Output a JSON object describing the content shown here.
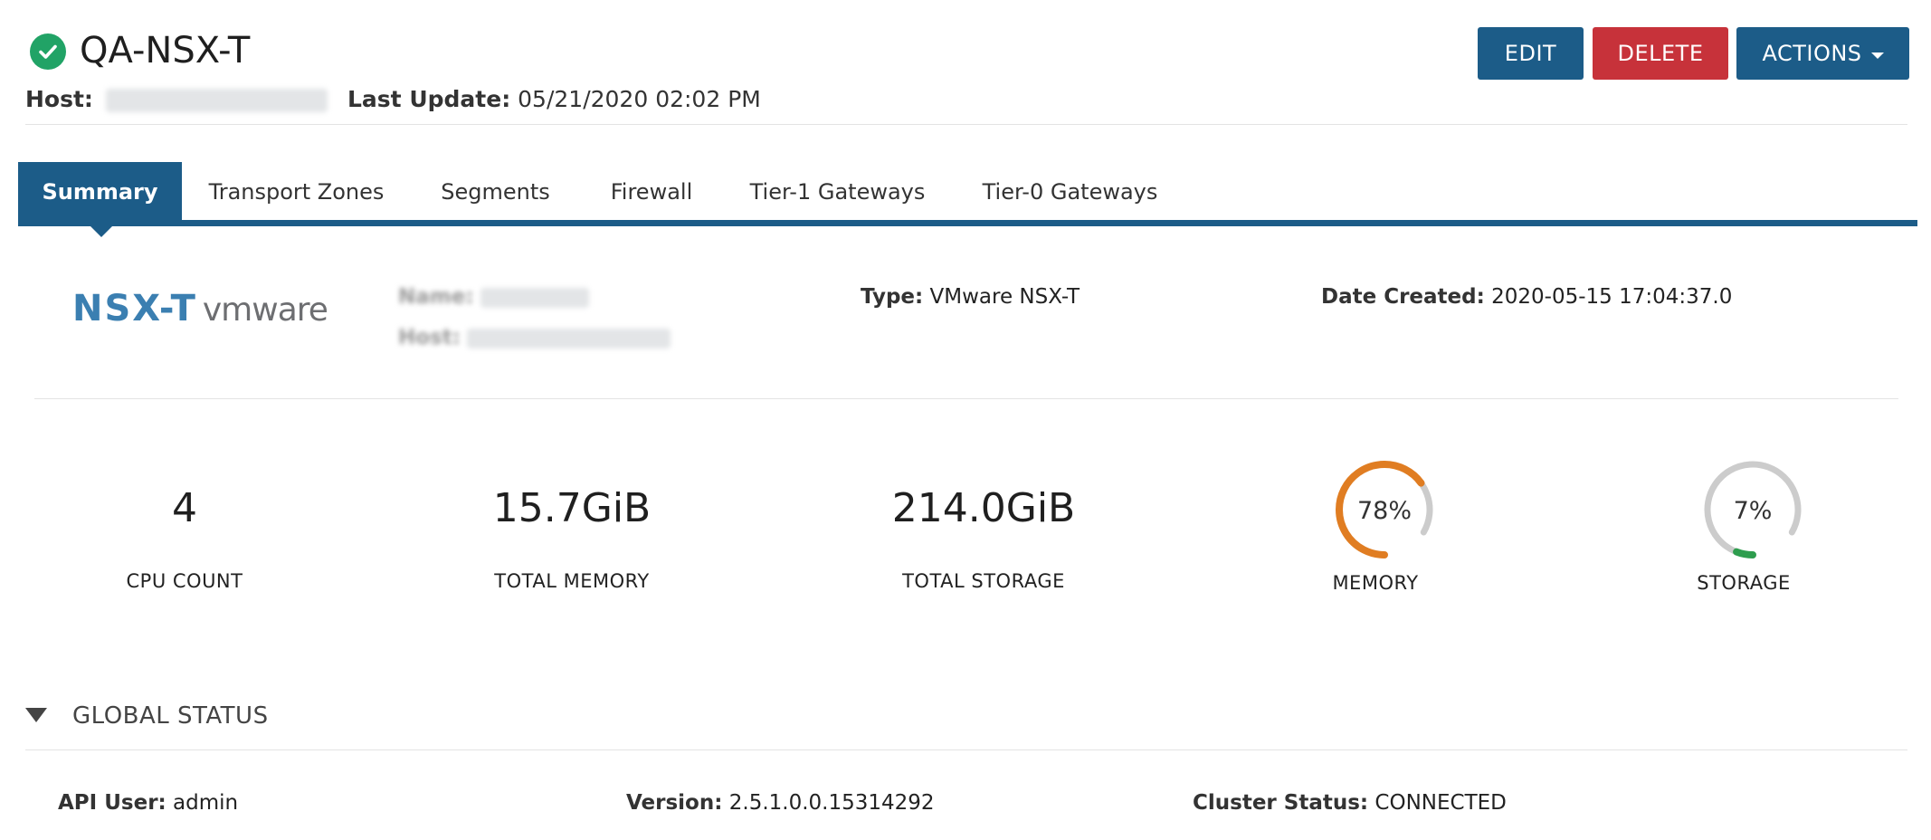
{
  "header": {
    "title": "QA-NSX-T",
    "status_icon": "check-circle-icon",
    "host_label": "Host:",
    "last_update_label": "Last Update:",
    "last_update_value": "05/21/2020 02:02 PM"
  },
  "toolbar": {
    "edit_label": "EDIT",
    "delete_label": "DELETE",
    "actions_label": "ACTIONS"
  },
  "tabs": [
    {
      "label": "Summary",
      "active": true
    },
    {
      "label": "Transport Zones",
      "active": false
    },
    {
      "label": "Segments",
      "active": false
    },
    {
      "label": "Firewall",
      "active": false
    },
    {
      "label": "Tier-1 Gateways",
      "active": false
    },
    {
      "label": "Tier-0 Gateways",
      "active": false
    }
  ],
  "logo": {
    "product": "NSX-T",
    "vendor": "vmware"
  },
  "details": {
    "name_label": "Name:",
    "host_label": "Host:",
    "type_label": "Type:",
    "type_value": "VMware NSX-T",
    "date_created_label": "Date Created:",
    "date_created_value": "2020-05-15 17:04:37.0"
  },
  "stats": {
    "cpu_count": {
      "value": "4",
      "label": "CPU COUNT"
    },
    "total_memory": {
      "value": "15.7GiB",
      "label": "TOTAL MEMORY"
    },
    "total_storage": {
      "value": "214.0GiB",
      "label": "TOTAL STORAGE"
    },
    "memory": {
      "percent": 78,
      "text": "78%",
      "label": "MEMORY",
      "color": "#e07d22"
    },
    "storage": {
      "percent": 7,
      "text": "7%",
      "label": "STORAGE",
      "color": "#2e9d4e"
    }
  },
  "global_status": {
    "title": "GLOBAL STATUS",
    "api_user_label": "API User:",
    "api_user_value": "admin",
    "version_label": "Version:",
    "version_value": "2.5.1.0.0.15314292",
    "cluster_status_label": "Cluster Status:",
    "cluster_status_value": "CONNECTED"
  },
  "colors": {
    "primary": "#1c5c88",
    "danger": "#c7323a",
    "success": "#21a366",
    "gauge_track": "#cccccc"
  }
}
